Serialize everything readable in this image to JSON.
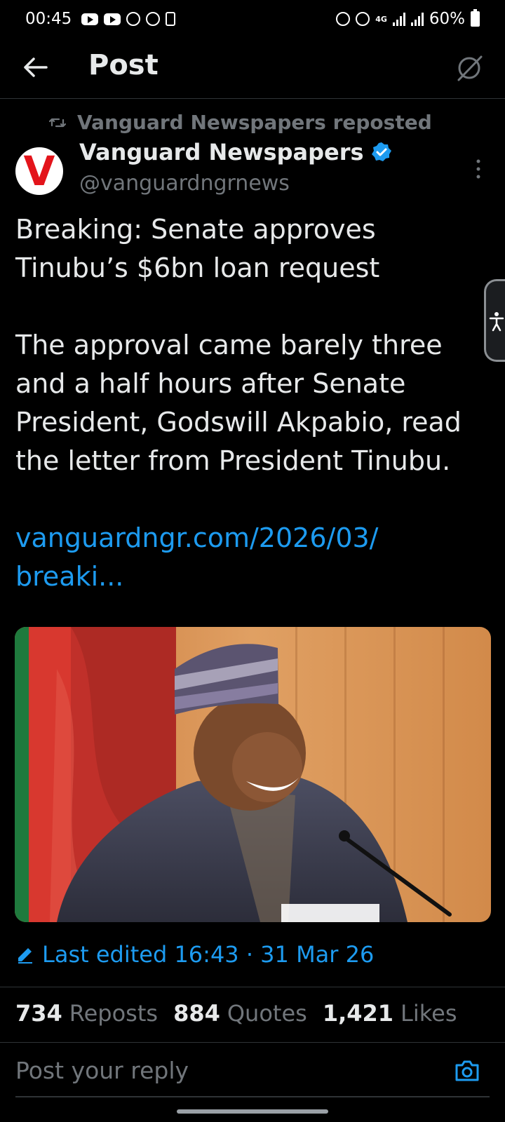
{
  "status_bar": {
    "time": "00:45",
    "network": "4G",
    "battery": "60%"
  },
  "header": {
    "title": "Post"
  },
  "post": {
    "repost_label": "Vanguard Newspapers reposted",
    "author_name": "Vanguard Newspapers",
    "author_handle": "@vanguardngrnews",
    "avatar_letter": "V",
    "paragraph1": "Breaking: Senate approves Tinubu’s $6bn loan request",
    "paragraph2": "The approval came barely three and a half hours after Senate President, Godswill Akpabio, read the letter from President Tinubu.",
    "link_line1": "vanguardngr.com/2026/03/",
    "link_line2": "breaki...",
    "edited_label": "Last edited 16:43 · 31 Mar 26",
    "reposts_count": "734",
    "reposts_label": "Reposts",
    "quotes_count": "884",
    "quotes_label": "Quotes",
    "likes_count": "1,421",
    "likes_label": "Likes"
  },
  "reply": {
    "placeholder": "Post your reply"
  },
  "colors": {
    "background": "#000000",
    "accent": "#1d9bf0",
    "muted": "#71767b",
    "text": "#e7e9ea",
    "avatar_red": "#e3141b"
  },
  "icons": [
    "back-arrow-icon",
    "grok-icon",
    "repost-icon",
    "verified-badge-icon",
    "more-options-icon",
    "edit-pencil-icon",
    "camera-icon",
    "accessibility-icon",
    "youtube-icon",
    "whatsapp-icon",
    "alarm-icon",
    "signal-icon",
    "battery-icon"
  ]
}
